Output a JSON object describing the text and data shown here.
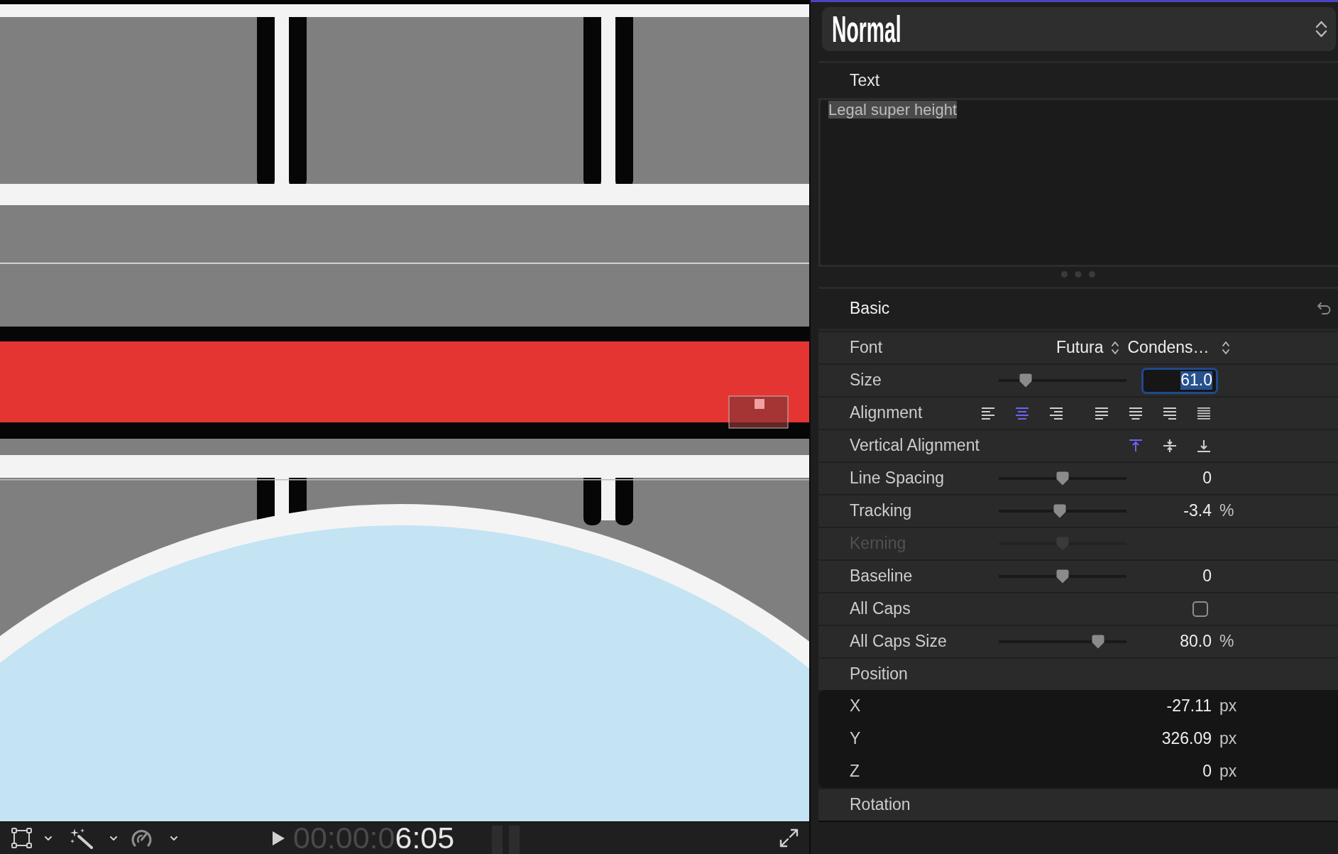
{
  "preset": {
    "label": "Normal"
  },
  "text_section": {
    "title": "Text",
    "value": "Legal super height",
    "selected": true
  },
  "basic": {
    "title": "Basic",
    "rows": [
      {
        "kind": "font",
        "label": "Font",
        "disabled": false,
        "family": "Futura",
        "typeface": "Condens…"
      },
      {
        "kind": "slider_field",
        "label": "Size",
        "disabled": false,
        "level": 0.21,
        "value": "61.0"
      },
      {
        "kind": "alignment",
        "label": "Alignment",
        "disabled": false,
        "options": [
          {
            "selected": false
          },
          {
            "selected": true
          },
          {
            "selected": false
          },
          {
            "selected": false
          },
          {
            "selected": false
          },
          {
            "selected": false
          },
          {
            "selected": false
          }
        ]
      },
      {
        "kind": "vertical_alignment",
        "label": "Vertical Alignment",
        "disabled": false,
        "options": [
          {
            "selected": true
          },
          {
            "selected": false
          },
          {
            "selected": false
          }
        ]
      },
      {
        "kind": "slider",
        "label": "Line Spacing",
        "disabled": false,
        "level": 0.5,
        "value": "0"
      },
      {
        "kind": "slider",
        "label": "Tracking",
        "disabled": false,
        "level": 0.48,
        "value": "-3.4",
        "unit": "%"
      },
      {
        "kind": "slider",
        "label": "Kerning",
        "disabled": true,
        "level": 0.5
      },
      {
        "kind": "slider",
        "label": "Baseline",
        "disabled": false,
        "level": 0.5,
        "value": "0"
      },
      {
        "kind": "checkbox",
        "label": "All Caps",
        "disabled": false,
        "checked": false
      },
      {
        "kind": "slider",
        "label": "All Caps Size",
        "disabled": false,
        "level": 0.78,
        "value": "80.0",
        "unit": "%"
      },
      {
        "kind": "group",
        "label": "Position",
        "disabled": false,
        "children": [
          {
            "label": "X",
            "value": "-27.11",
            "unit": "px"
          },
          {
            "label": "Y",
            "value": "326.09",
            "unit": "px"
          },
          {
            "label": "Z",
            "value": "0",
            "unit": "px"
          }
        ]
      },
      {
        "kind": "group",
        "label": "Rotation",
        "disabled": false
      }
    ]
  },
  "viewer_toolbar": {
    "timecode": {
      "leading": "00:00:0",
      "current": "6:05"
    }
  }
}
